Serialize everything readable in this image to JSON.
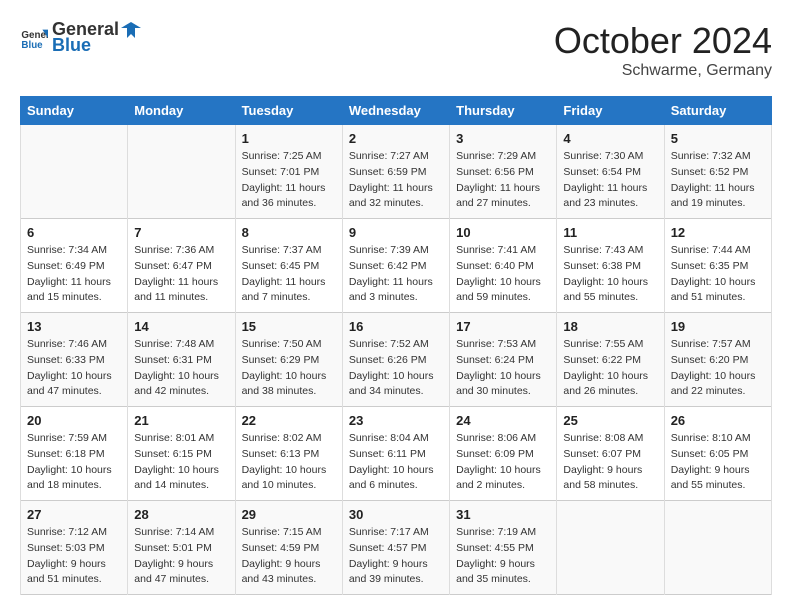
{
  "header": {
    "logo_general": "General",
    "logo_blue": "Blue",
    "month": "October 2024",
    "location": "Schwarme, Germany"
  },
  "days_of_week": [
    "Sunday",
    "Monday",
    "Tuesday",
    "Wednesday",
    "Thursday",
    "Friday",
    "Saturday"
  ],
  "weeks": [
    [
      {
        "day": "",
        "sunrise": "",
        "sunset": "",
        "daylight": ""
      },
      {
        "day": "",
        "sunrise": "",
        "sunset": "",
        "daylight": ""
      },
      {
        "day": "1",
        "sunrise": "Sunrise: 7:25 AM",
        "sunset": "Sunset: 7:01 PM",
        "daylight": "Daylight: 11 hours and 36 minutes."
      },
      {
        "day": "2",
        "sunrise": "Sunrise: 7:27 AM",
        "sunset": "Sunset: 6:59 PM",
        "daylight": "Daylight: 11 hours and 32 minutes."
      },
      {
        "day": "3",
        "sunrise": "Sunrise: 7:29 AM",
        "sunset": "Sunset: 6:56 PM",
        "daylight": "Daylight: 11 hours and 27 minutes."
      },
      {
        "day": "4",
        "sunrise": "Sunrise: 7:30 AM",
        "sunset": "Sunset: 6:54 PM",
        "daylight": "Daylight: 11 hours and 23 minutes."
      },
      {
        "day": "5",
        "sunrise": "Sunrise: 7:32 AM",
        "sunset": "Sunset: 6:52 PM",
        "daylight": "Daylight: 11 hours and 19 minutes."
      }
    ],
    [
      {
        "day": "6",
        "sunrise": "Sunrise: 7:34 AM",
        "sunset": "Sunset: 6:49 PM",
        "daylight": "Daylight: 11 hours and 15 minutes."
      },
      {
        "day": "7",
        "sunrise": "Sunrise: 7:36 AM",
        "sunset": "Sunset: 6:47 PM",
        "daylight": "Daylight: 11 hours and 11 minutes."
      },
      {
        "day": "8",
        "sunrise": "Sunrise: 7:37 AM",
        "sunset": "Sunset: 6:45 PM",
        "daylight": "Daylight: 11 hours and 7 minutes."
      },
      {
        "day": "9",
        "sunrise": "Sunrise: 7:39 AM",
        "sunset": "Sunset: 6:42 PM",
        "daylight": "Daylight: 11 hours and 3 minutes."
      },
      {
        "day": "10",
        "sunrise": "Sunrise: 7:41 AM",
        "sunset": "Sunset: 6:40 PM",
        "daylight": "Daylight: 10 hours and 59 minutes."
      },
      {
        "day": "11",
        "sunrise": "Sunrise: 7:43 AM",
        "sunset": "Sunset: 6:38 PM",
        "daylight": "Daylight: 10 hours and 55 minutes."
      },
      {
        "day": "12",
        "sunrise": "Sunrise: 7:44 AM",
        "sunset": "Sunset: 6:35 PM",
        "daylight": "Daylight: 10 hours and 51 minutes."
      }
    ],
    [
      {
        "day": "13",
        "sunrise": "Sunrise: 7:46 AM",
        "sunset": "Sunset: 6:33 PM",
        "daylight": "Daylight: 10 hours and 47 minutes."
      },
      {
        "day": "14",
        "sunrise": "Sunrise: 7:48 AM",
        "sunset": "Sunset: 6:31 PM",
        "daylight": "Daylight: 10 hours and 42 minutes."
      },
      {
        "day": "15",
        "sunrise": "Sunrise: 7:50 AM",
        "sunset": "Sunset: 6:29 PM",
        "daylight": "Daylight: 10 hours and 38 minutes."
      },
      {
        "day": "16",
        "sunrise": "Sunrise: 7:52 AM",
        "sunset": "Sunset: 6:26 PM",
        "daylight": "Daylight: 10 hours and 34 minutes."
      },
      {
        "day": "17",
        "sunrise": "Sunrise: 7:53 AM",
        "sunset": "Sunset: 6:24 PM",
        "daylight": "Daylight: 10 hours and 30 minutes."
      },
      {
        "day": "18",
        "sunrise": "Sunrise: 7:55 AM",
        "sunset": "Sunset: 6:22 PM",
        "daylight": "Daylight: 10 hours and 26 minutes."
      },
      {
        "day": "19",
        "sunrise": "Sunrise: 7:57 AM",
        "sunset": "Sunset: 6:20 PM",
        "daylight": "Daylight: 10 hours and 22 minutes."
      }
    ],
    [
      {
        "day": "20",
        "sunrise": "Sunrise: 7:59 AM",
        "sunset": "Sunset: 6:18 PM",
        "daylight": "Daylight: 10 hours and 18 minutes."
      },
      {
        "day": "21",
        "sunrise": "Sunrise: 8:01 AM",
        "sunset": "Sunset: 6:15 PM",
        "daylight": "Daylight: 10 hours and 14 minutes."
      },
      {
        "day": "22",
        "sunrise": "Sunrise: 8:02 AM",
        "sunset": "Sunset: 6:13 PM",
        "daylight": "Daylight: 10 hours and 10 minutes."
      },
      {
        "day": "23",
        "sunrise": "Sunrise: 8:04 AM",
        "sunset": "Sunset: 6:11 PM",
        "daylight": "Daylight: 10 hours and 6 minutes."
      },
      {
        "day": "24",
        "sunrise": "Sunrise: 8:06 AM",
        "sunset": "Sunset: 6:09 PM",
        "daylight": "Daylight: 10 hours and 2 minutes."
      },
      {
        "day": "25",
        "sunrise": "Sunrise: 8:08 AM",
        "sunset": "Sunset: 6:07 PM",
        "daylight": "Daylight: 9 hours and 58 minutes."
      },
      {
        "day": "26",
        "sunrise": "Sunrise: 8:10 AM",
        "sunset": "Sunset: 6:05 PM",
        "daylight": "Daylight: 9 hours and 55 minutes."
      }
    ],
    [
      {
        "day": "27",
        "sunrise": "Sunrise: 7:12 AM",
        "sunset": "Sunset: 5:03 PM",
        "daylight": "Daylight: 9 hours and 51 minutes."
      },
      {
        "day": "28",
        "sunrise": "Sunrise: 7:14 AM",
        "sunset": "Sunset: 5:01 PM",
        "daylight": "Daylight: 9 hours and 47 minutes."
      },
      {
        "day": "29",
        "sunrise": "Sunrise: 7:15 AM",
        "sunset": "Sunset: 4:59 PM",
        "daylight": "Daylight: 9 hours and 43 minutes."
      },
      {
        "day": "30",
        "sunrise": "Sunrise: 7:17 AM",
        "sunset": "Sunset: 4:57 PM",
        "daylight": "Daylight: 9 hours and 39 minutes."
      },
      {
        "day": "31",
        "sunrise": "Sunrise: 7:19 AM",
        "sunset": "Sunset: 4:55 PM",
        "daylight": "Daylight: 9 hours and 35 minutes."
      },
      {
        "day": "",
        "sunrise": "",
        "sunset": "",
        "daylight": ""
      },
      {
        "day": "",
        "sunrise": "",
        "sunset": "",
        "daylight": ""
      }
    ]
  ]
}
